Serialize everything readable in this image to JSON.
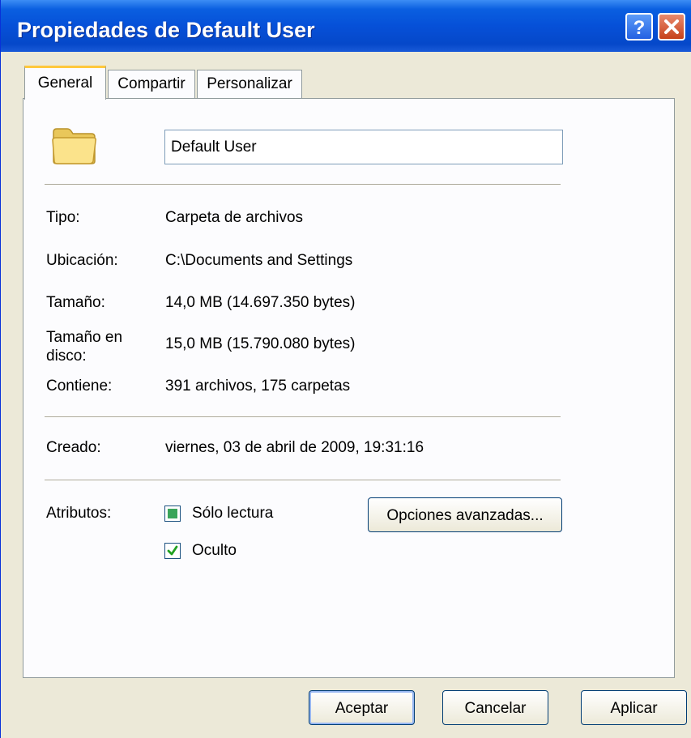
{
  "window": {
    "title": "Propiedades de Default User"
  },
  "tabs": [
    {
      "label": "General"
    },
    {
      "label": "Compartir"
    },
    {
      "label": "Personalizar"
    }
  ],
  "general": {
    "name_value": "Default User",
    "fields": {
      "tipo": {
        "label": "Tipo:",
        "value": "Carpeta de archivos"
      },
      "ubicacion": {
        "label": "Ubicación:",
        "value": "C:\\Documents and Settings"
      },
      "tamano": {
        "label": "Tamaño:",
        "value": "14,0 MB (14.697.350 bytes)"
      },
      "tamano_disco": {
        "label": "Tamaño en disco:",
        "value": "15,0 MB (15.790.080 bytes)"
      },
      "contiene": {
        "label": "Contiene:",
        "value": "391 archivos, 175 carpetas"
      },
      "creado": {
        "label": "Creado:",
        "value": "viernes, 03 de abril de 2009, 19:31:16"
      }
    },
    "attributes_label": "Atributos:",
    "readonly": {
      "label": "Sólo lectura",
      "state": "mixed"
    },
    "hidden": {
      "label": "Oculto",
      "state": "checked"
    },
    "advanced_button": "Opciones avanzadas..."
  },
  "footer": {
    "ok": "Aceptar",
    "cancel": "Cancelar",
    "apply": "Aplicar"
  },
  "colors": {
    "titlebar": "#0650d8",
    "dialog_bg": "#ECE9D8",
    "panel_bg": "#fcfcfe",
    "tab_highlight": "#ffc83c",
    "check_green": "#3ba55a"
  },
  "icons": {
    "folder": "folder-icon",
    "help": "help-icon",
    "close": "close-icon",
    "check": "check-icon"
  }
}
